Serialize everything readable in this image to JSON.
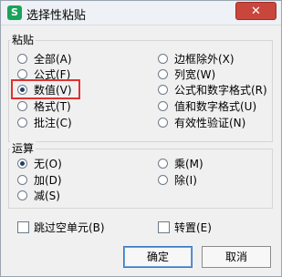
{
  "window": {
    "title": "选择性粘贴",
    "app_icon_glyph": "S",
    "close_glyph": "✕"
  },
  "paste_group": {
    "label": "粘贴",
    "left_options": [
      "全部(A)",
      "公式(F)",
      "数值(V)",
      "格式(T)",
      "批注(C)"
    ],
    "right_options": [
      "边框除外(X)",
      "列宽(W)",
      "公式和数字格式(R)",
      "值和数字格式(U)",
      "有效性验证(N)"
    ],
    "selected": "数值(V)"
  },
  "operation_group": {
    "label": "运算",
    "left_options": [
      "无(O)",
      "加(D)",
      "减(S)"
    ],
    "right_options": [
      "乘(M)",
      "除(I)"
    ],
    "selected": "无(O)"
  },
  "checkboxes": {
    "skip_blanks": "跳过空单元(B)",
    "transpose": "转置(E)"
  },
  "buttons": {
    "ok": "确定",
    "cancel": "取消"
  },
  "colors": {
    "highlight_box": "#e0312f",
    "app_icon": "#1aa35a",
    "close_button": "#c9463d"
  }
}
